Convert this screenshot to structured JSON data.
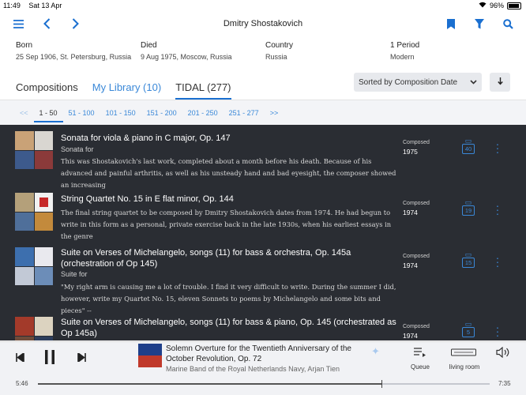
{
  "status": {
    "time": "11:49",
    "date": "Sat 13 Apr",
    "battery": "96%",
    "battery_level": 0.96
  },
  "header": {
    "title": "Dmitry Shostakovich"
  },
  "info": [
    {
      "label": "Born",
      "value": "25 Sep 1906, St. Petersburg, Russia"
    },
    {
      "label": "Died",
      "value": "9 Aug 1975, Moscow, Russia"
    },
    {
      "label": "Country",
      "value": "Russia"
    },
    {
      "label": "1 Period",
      "value": "Modern"
    }
  ],
  "tabs": {
    "compositions": "Compositions",
    "library": "My Library (10)",
    "tidal": "TIDAL (277)"
  },
  "sort": {
    "label": "Sorted by Composition Date"
  },
  "pagination": {
    "prev": "<<",
    "next": ">>",
    "pages": [
      "1 - 50",
      "51 - 100",
      "101 - 150",
      "151 - 200",
      "201 - 250",
      "251 - 277"
    ]
  },
  "compositions": [
    {
      "title": "Sonata for viola & piano in C major, Op. 147",
      "subtitle": "Sonata for",
      "description": "This was Shostakovich's last work, completed about a month before his death. Because of his advanced and painful arthritis, as well as his unsteady hand and bad eyesight, the composer showed an increasing",
      "composed_label": "Composed",
      "year": "1975",
      "count": "40"
    },
    {
      "title": "String Quartet No. 15 in E flat minor, Op. 144",
      "subtitle": "",
      "description": "The final string quartet to be composed by Dmitry Shostakovich dates from 1974. He had begun to write in this form as a personal, private exercise back in the late 1930s, when his earliest essays in the genre",
      "composed_label": "Composed",
      "year": "1974",
      "count": "19"
    },
    {
      "title": "Suite on Verses of Michelangelo, songs (11) for bass & orchestra, Op. 145a (orchestration of Op 145)",
      "subtitle": "Suite for",
      "description": "\"My right arm is causing me a lot of trouble. I find it very difficult to write. During the summer I did, however, write my Quartet No. 15, eleven Sonnets to poems by Michelangelo and some bits and pieces\" --",
      "composed_label": "Composed",
      "year": "1974",
      "count": "15"
    },
    {
      "title": "Suite on Verses of Michelangelo, songs (11) for bass & piano, Op. 145 (orchestrated as Op 145a)",
      "subtitle": "",
      "description": "",
      "composed_label": "Composed",
      "year": "1974",
      "count": "5"
    }
  ],
  "player": {
    "title": "Solemn Overture for the Twentieth Anniversary of the October Revolution, Op. 72",
    "artist": "Marine Band of the Royal Netherlands Navy, Arjan Tien",
    "elapsed": "5:46",
    "duration": "7:35",
    "progress": 0.76,
    "queue_label": "Queue",
    "zone_label": "living room"
  },
  "colors": {
    "accent": "#1a6fd0",
    "list_bg": "#2a2d33",
    "link": "#3a88d8"
  }
}
